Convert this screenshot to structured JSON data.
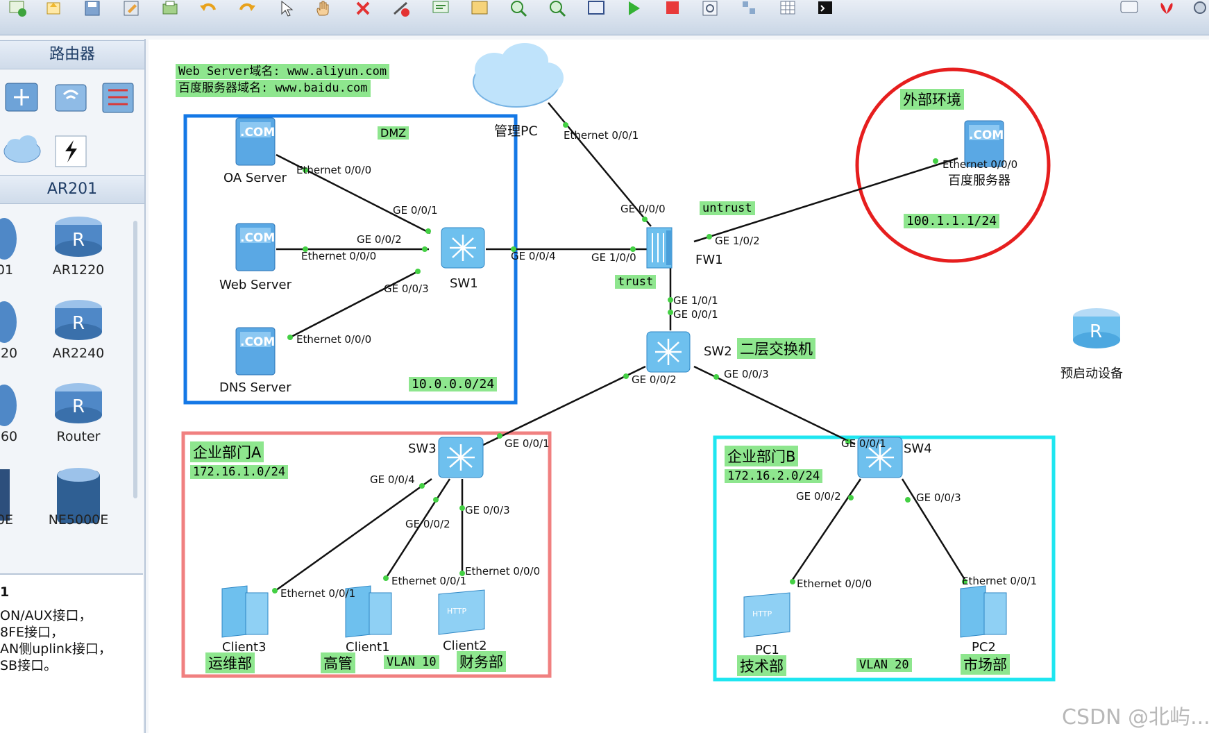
{
  "toolbar": {
    "icons": [
      "new-topo-icon",
      "open-icon",
      "save-icon",
      "save-as-icon",
      "print-icon",
      "undo-icon",
      "redo-icon",
      "pointer-icon",
      "hand-icon",
      "delete-icon",
      "delete-link-icon",
      "text-icon",
      "rectangle-icon",
      "zoom-in-icon",
      "zoom-out-icon",
      "fit-icon",
      "start-icon",
      "stop-icon",
      "capture-icon",
      "topology-icon",
      "grid-icon",
      "console-icon",
      "chat-icon",
      "huawei-icon",
      "settings-icon"
    ]
  },
  "left_panel": {
    "section1_title": "路由器",
    "section2_title": "AR201",
    "devices": [
      {
        "label": "01"
      },
      {
        "label": "AR1220"
      },
      {
        "label": "220"
      },
      {
        "label": "AR2240"
      },
      {
        "label": "260"
      },
      {
        "label": "Router"
      },
      {
        "label": "0E"
      },
      {
        "label": "NE5000E"
      }
    ],
    "description": {
      "title": "1",
      "lines": [
        "ON/AUX接口，",
        "8FE接口，",
        "AN侧uplink接口，",
        "SB接口。"
      ]
    }
  },
  "topology": {
    "notes": {
      "line1": "Web Server域名: www.aliyun.com",
      "line2": "百度服务器域名: www.baidu.com"
    },
    "zones": {
      "dmz": {
        "label": "DMZ",
        "subnet": "10.0.0.0/24",
        "color": "#1478e6"
      },
      "external": {
        "label": "外部环境",
        "subnet": "100.1.1.1/24",
        "color": "#e61e1e"
      },
      "dept_a": {
        "label": "企业部门A",
        "subnet": "172.16.1.0/24",
        "vlan": "VLAN 10",
        "color": "#f08080"
      },
      "dept_b": {
        "label": "企业部门B",
        "subnet": "172.16.2.0/24",
        "vlan": "VLAN 20",
        "color": "#1ee6f0"
      }
    },
    "fw_zones": {
      "untrust": "untrust",
      "trust": "trust"
    },
    "devices": {
      "oa_server": "OA Server",
      "web_server": "Web Server",
      "dns_server": "DNS Server",
      "sw1": "SW1",
      "cloud": "管理PC",
      "fw1": "FW1",
      "sw2": "SW2",
      "sw2_note": "二层交换机",
      "baidu": "百度服务器",
      "sw3": "SW3",
      "sw4": "SW4",
      "client3": "Client3",
      "client1": "Client1",
      "client2": "Client2",
      "pc1": "PC1",
      "pc2": "PC2",
      "preboot": "预启动设备"
    },
    "dept_labels": {
      "client3": "运维部",
      "client1": "高管",
      "client2": "财务部",
      "pc1": "技术部",
      "pc2": "市场部"
    },
    "ports": {
      "oa_eth": "Ethernet 0/0/0",
      "sw1_g1": "GE 0/0/1",
      "sw1_g2": "GE 0/0/2",
      "web_eth": "Ethernet 0/0/0",
      "sw1_g3": "GE 0/0/3",
      "dns_eth": "Ethernet 0/0/0",
      "sw1_g4": "GE 0/0/4",
      "fw_g100": "GE 1/0/0",
      "cloud_eth": "Ethernet 0/0/1",
      "fw_g000": "GE 0/0/0",
      "fw_g102": "GE 1/0/2",
      "baidu_eth": "Ethernet 0/0/0",
      "fw_g101": "GE 1/0/1",
      "sw2_g1": "GE 0/0/1",
      "sw2_g2": "GE 0/0/2",
      "sw2_g3": "GE 0/0/3",
      "sw3_g1": "GE 0/0/1",
      "sw3_g4": "GE 0/0/4",
      "sw3_g2": "GE 0/0/2",
      "sw3_g3": "GE 0/0/3",
      "c3_eth": "Ethernet 0/0/1",
      "c1_eth": "Ethernet 0/0/1",
      "c2_eth": "Ethernet 0/0/0",
      "sw4_g1": "GE 0/0/1",
      "sw4_g2": "GE 0/0/2",
      "sw4_g3": "GE 0/0/3",
      "pc1_eth": "Ethernet 0/0/0",
      "pc2_eth": "Ethernet 0/0/1"
    }
  },
  "watermark": "CSDN @北屿..."
}
